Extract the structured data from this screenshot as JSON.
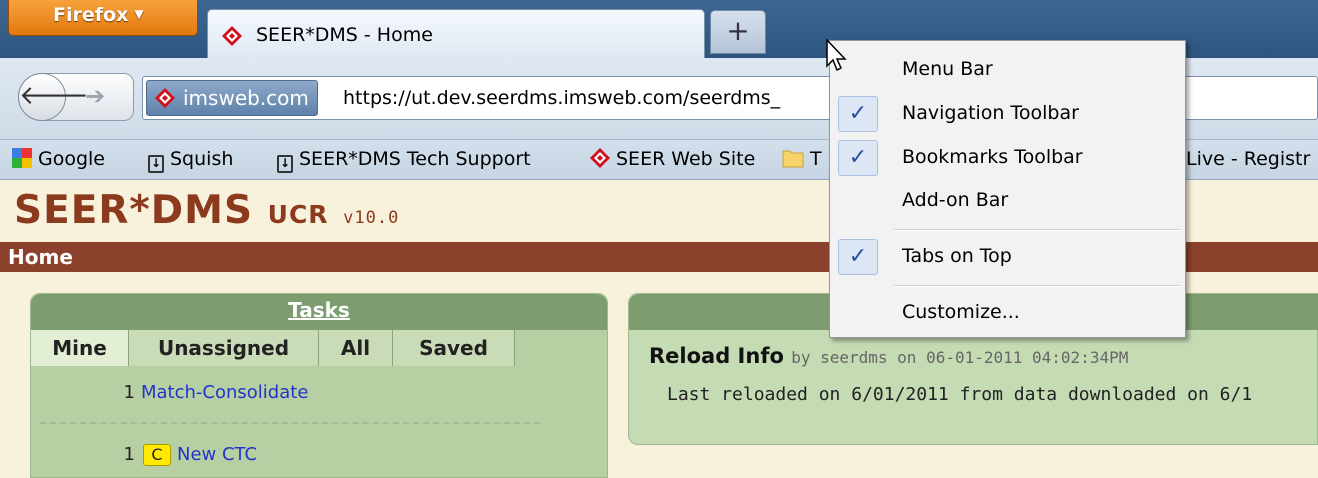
{
  "browser": {
    "app_button": "Firefox",
    "tab_title": "SEER*DMS - Home",
    "new_tab_symbol": "+",
    "identity": "imsweb.com",
    "url": "https://ut.dev.seerdms.imsweb.com/seerdms_"
  },
  "bookmarks": [
    {
      "label": "Google",
      "icon": "google-icon"
    },
    {
      "label": "Squish",
      "icon": "pushpin-icon"
    },
    {
      "label": "SEER*DMS Tech Support",
      "icon": "pushpin-icon"
    },
    {
      "label": "SEER Web Site",
      "icon": "seer-diamond-icon"
    },
    {
      "label": "T",
      "icon": "folder-icon"
    },
    {
      "label": "Live - Registr",
      "icon": ""
    }
  ],
  "app": {
    "name": "SEER*DMS",
    "module": "UCR",
    "version": "v10.0",
    "section": "Home"
  },
  "tasks": {
    "header": "Tasks",
    "tabs": [
      "Mine",
      "Unassigned",
      "All",
      "Saved"
    ],
    "active_tab": "Mine",
    "rows": [
      {
        "count": "1",
        "label": "Match-Consolidate"
      },
      {
        "count": "1",
        "badge": "C",
        "label": "New CTC"
      }
    ]
  },
  "reload": {
    "title": "Reload Info",
    "byline": "by seerdms on 06-01-2011 04:02:34PM",
    "body": "Last reloaded on 6/01/2011 from data downloaded on 6/1"
  },
  "context_menu": {
    "items": [
      {
        "label": "Menu Bar",
        "mnemonic": "M",
        "checked": false
      },
      {
        "label": "Navigation Toolbar",
        "mnemonic": "N",
        "checked": true
      },
      {
        "label": "Bookmarks Toolbar",
        "mnemonic": "B",
        "checked": true
      },
      {
        "label": "Add-on Bar",
        "mnemonic": "A",
        "checked": false
      },
      {
        "label": "Tabs on Top",
        "mnemonic": "T",
        "checked": true
      },
      {
        "label": "Customize...",
        "mnemonic": "C",
        "checked": false
      }
    ],
    "checkmark": "✓"
  }
}
